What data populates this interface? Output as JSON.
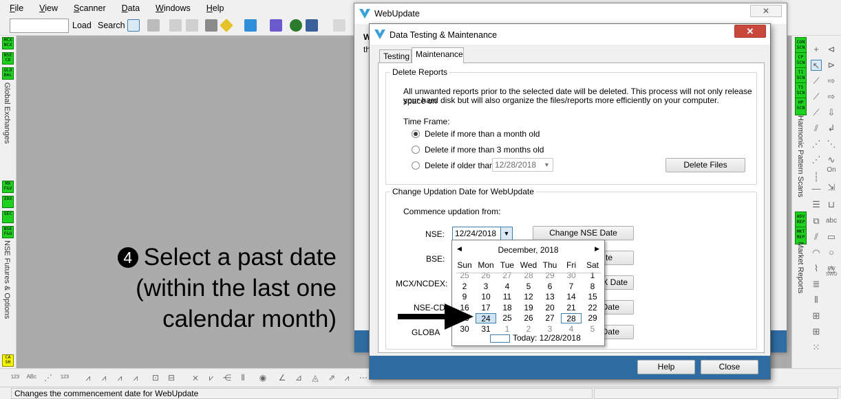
{
  "menu": [
    "File",
    "View",
    "Scanner",
    "Data",
    "Windows",
    "Help"
  ],
  "toolbar": {
    "load_label": "Load",
    "search_label": "Search"
  },
  "left_panel": {
    "top_buttons": [
      "MCX NCX",
      "NSE CD",
      "GLO BAL"
    ],
    "top_label": "Global Exchanges",
    "bottom_buttons": [
      "MX F&V",
      "IDX",
      "SEC",
      "NSE F&O"
    ],
    "bottom_label": "NSE Futures & Options",
    "foot_button": "CA SH"
  },
  "right_panel": {
    "scan_buttons": [
      "CON SCN",
      "CP SCN",
      "TI SCN",
      "TS SCN",
      "HP SCN"
    ],
    "scan_label": "Harmonic Pattern Scans",
    "report_buttons": [
      "ADV REP",
      "MKT REP"
    ],
    "report_label": "Market Reports",
    "tool_on_label": "On",
    "tool_abc_label": "abc",
    "tool_ew_label": "EW SWG"
  },
  "status": {
    "message": "Changes the commencement date for WebUpdate"
  },
  "caption": {
    "badge": "4",
    "lines": [
      "Select a past date",
      "(within the last one",
      "calendar month)"
    ]
  },
  "webupdate_window": {
    "title": "WebUpdate",
    "close_glyph": "✕",
    "hidden_label_1": "W",
    "hidden_label_2": "th"
  },
  "dialog": {
    "title": "Data Testing & Maintenance",
    "close_glyph": "✕",
    "tabs": [
      "Testing",
      "Maintenance"
    ],
    "delete_reports": {
      "title": "Delete Reports",
      "description_line1": "All unwanted reports prior to the selected date will be deleted. This process will not only release space on",
      "description_line2": "your hard disk but will also organize the files/reports more efficiently on your computer.",
      "timeframe_label": "Time Frame:",
      "options": [
        "Delete if more than a month old",
        "Delete if more than 3 months old",
        "Delete if older than"
      ],
      "older_than_date": "12/28/2018",
      "delete_button": "Delete Files"
    },
    "change_updation": {
      "title": "Change Updation Date for WebUpdate",
      "commence_label": "Commence updation from:",
      "nse_label": "NSE:",
      "nse_date": "12/24/2018",
      "nse_button": "Change NSE Date",
      "bse_label": "BSE:",
      "bse_button_tail": "te",
      "mcx_label": "MCX/NCDEX:",
      "mcx_button_tail": "X Date",
      "nsecd_label": "NSE-CD",
      "nsecd_button_tail": "Date",
      "global_label": "GLOBA",
      "global_button_tail": "Date"
    },
    "help_button": "Help",
    "close_button": "Close"
  },
  "calendar": {
    "month_label": "December, 2018",
    "weekdays": [
      "Sun",
      "Mon",
      "Tue",
      "Wed",
      "Thu",
      "Fri",
      "Sat"
    ],
    "weeks": [
      [
        "25",
        "26",
        "27",
        "28",
        "29",
        "30",
        "1"
      ],
      [
        "2",
        "3",
        "4",
        "5",
        "6",
        "7",
        "8"
      ],
      [
        "9",
        "10",
        "11",
        "12",
        "13",
        "14",
        "15"
      ],
      [
        "16",
        "17",
        "18",
        "19",
        "20",
        "21",
        "22"
      ],
      [
        "23",
        "24",
        "25",
        "26",
        "27",
        "28",
        "29"
      ],
      [
        "30",
        "31",
        "1",
        "2",
        "3",
        "4",
        "5"
      ]
    ],
    "selected": "24",
    "today_cell": "28",
    "today_label": "Today: 12/28/2018"
  },
  "colors": {
    "accent_blue": "#2f6ca2",
    "workspace_grey": "#ababab",
    "scan_green": "#1ed11e"
  }
}
